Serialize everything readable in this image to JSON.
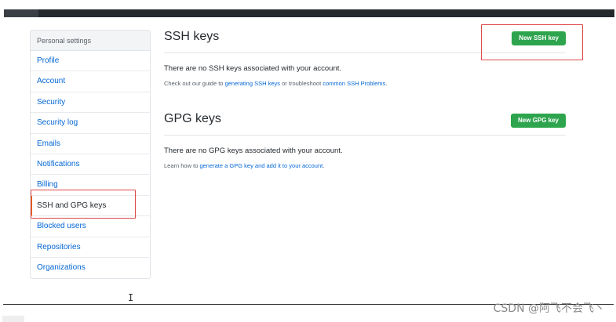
{
  "sidebar": {
    "header": "Personal settings",
    "items": [
      {
        "label": "Profile"
      },
      {
        "label": "Account"
      },
      {
        "label": "Security"
      },
      {
        "label": "Security log"
      },
      {
        "label": "Emails"
      },
      {
        "label": "Notifications"
      },
      {
        "label": "Billing"
      },
      {
        "label": "SSH and GPG keys",
        "active": true
      },
      {
        "label": "Blocked users"
      },
      {
        "label": "Repositories"
      },
      {
        "label": "Organizations"
      }
    ]
  },
  "ssh": {
    "title": "SSH keys",
    "button": "New SSH key",
    "message": "There are no SSH keys associated with your account.",
    "guide_prefix": "Check out our guide to ",
    "guide_link": "generating SSH keys",
    "guide_middle": " or troubleshoot ",
    "guide_link2": "common SSH Problems",
    "guide_suffix": "."
  },
  "gpg": {
    "title": "GPG keys",
    "button": "New GPG key",
    "message": "There are no GPG keys associated with your account.",
    "learn_prefix": "Learn how to ",
    "learn_link": "generate a GPG key and add it to your account",
    "learn_suffix": "."
  },
  "watermark": "CSDN @阿飞不会飞丶",
  "colors": {
    "accent": "#0366d6",
    "button_green": "#2ea44f",
    "annotation_red": "#e04848",
    "active_marker": "#e36209"
  }
}
